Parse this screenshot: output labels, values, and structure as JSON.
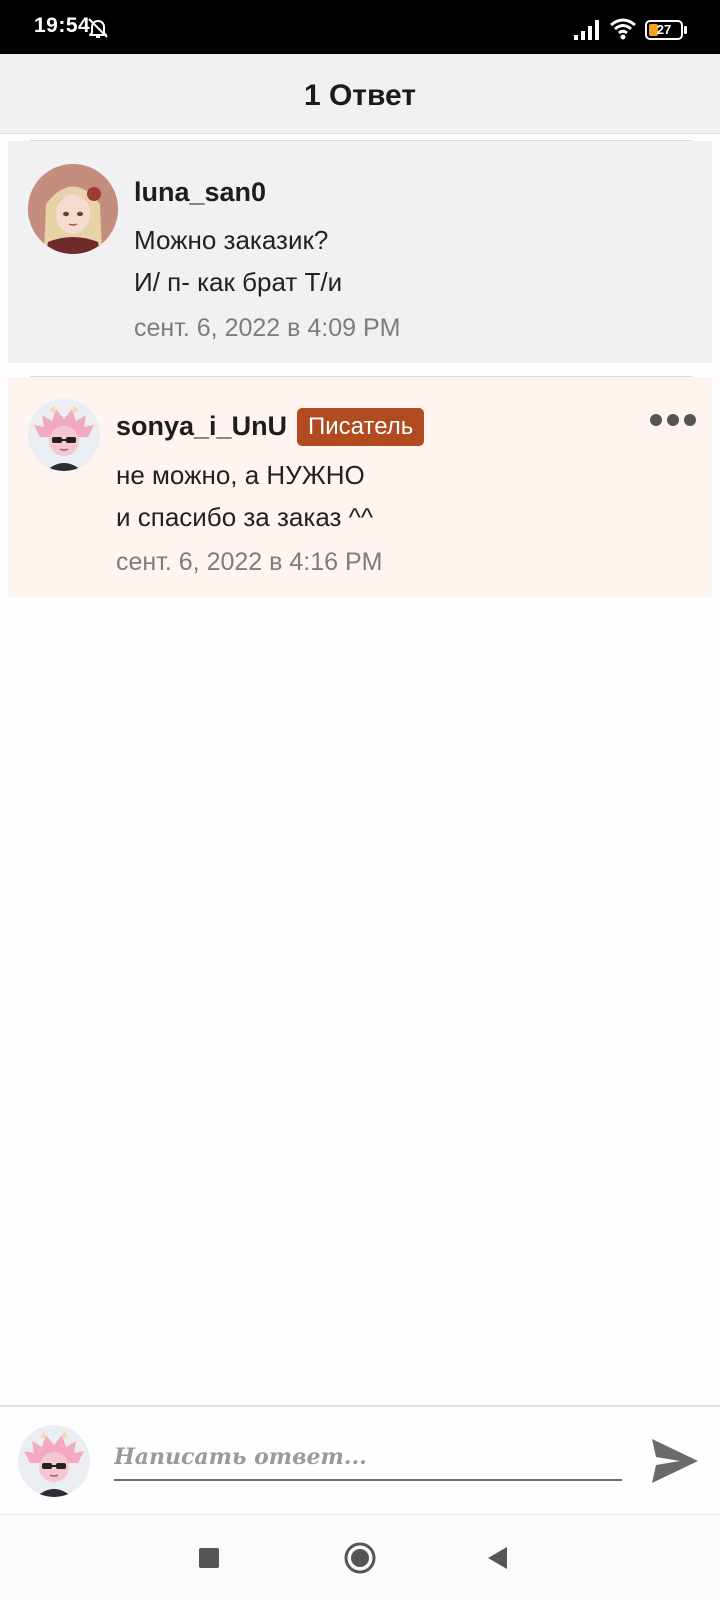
{
  "status_bar": {
    "time": "19:54",
    "battery": "27"
  },
  "header": {
    "title": "1 Ответ"
  },
  "original_comment": {
    "username": "luna_san0",
    "lines": [
      "Можно заказик?",
      "И/ п- как брат Т/и"
    ],
    "timestamp": "сент. 6, 2022 в 4:09 PM"
  },
  "reply_comment": {
    "username": "sonya_i_UnU",
    "badge": "Писатель",
    "lines": [
      "не можно, а НУЖНО",
      "и спасибо за заказ ^^"
    ],
    "timestamp": "сент. 6, 2022 в 4:16 PM"
  },
  "reply_bar": {
    "placeholder": "Написать ответ..."
  },
  "colors": {
    "badge": "#b24a1f",
    "reply_background": "#fff4ef",
    "original_background": "#f1f1f4",
    "battery_fill": "#f7a21b"
  },
  "icons": {
    "status": [
      "bell-off-icon",
      "signal-icon",
      "wifi-icon",
      "battery-icon"
    ],
    "actions": [
      "more-dots-icon",
      "send-icon"
    ],
    "nav": [
      "stop-square-icon",
      "home-circle-icon",
      "back-triangle-icon"
    ]
  }
}
